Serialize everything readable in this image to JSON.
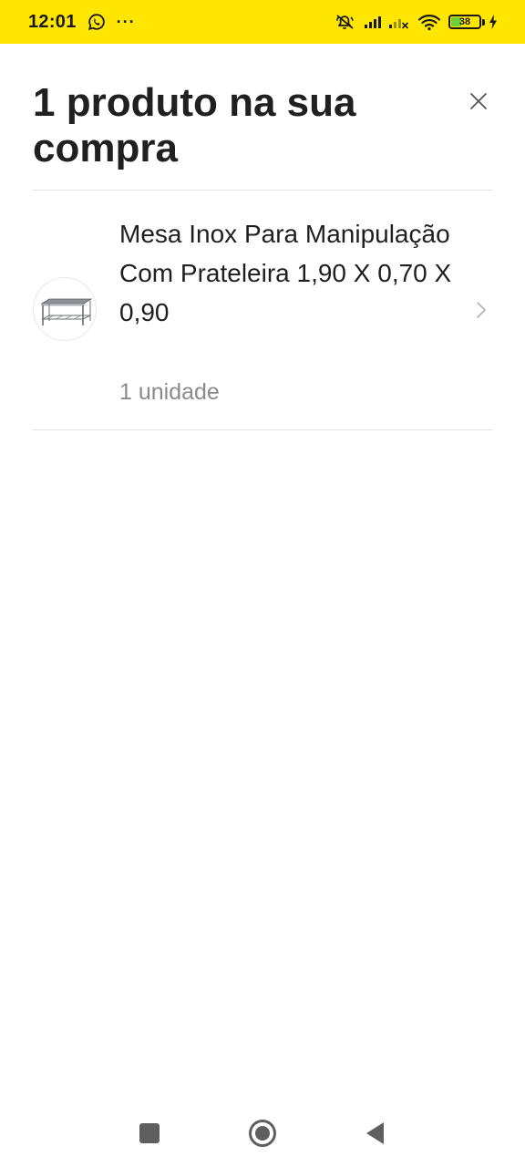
{
  "status_bar": {
    "time": "12:01",
    "overflow": "···",
    "battery_level": "38",
    "battery_fraction": 0.38,
    "background_color": "#ffe600",
    "icons": [
      "whatsapp-icon",
      "more-icon",
      "mute-icon",
      "signal-icon",
      "signal-weak-icon",
      "wifi-icon",
      "battery-icon",
      "charging-icon"
    ]
  },
  "header": {
    "title": "1 produto na sua compra",
    "close_icon": "close-icon"
  },
  "products": [
    {
      "name": "Mesa Inox Para Manipulação Com Prateleira 1,90 X 0,70 X 0,90",
      "quantity": "1 unidade",
      "image_icon": "stainless-table-icon",
      "chevron_icon": "chevron-right-icon"
    }
  ],
  "nav_bar": {
    "buttons": [
      "recents-button",
      "home-button",
      "back-button"
    ]
  }
}
